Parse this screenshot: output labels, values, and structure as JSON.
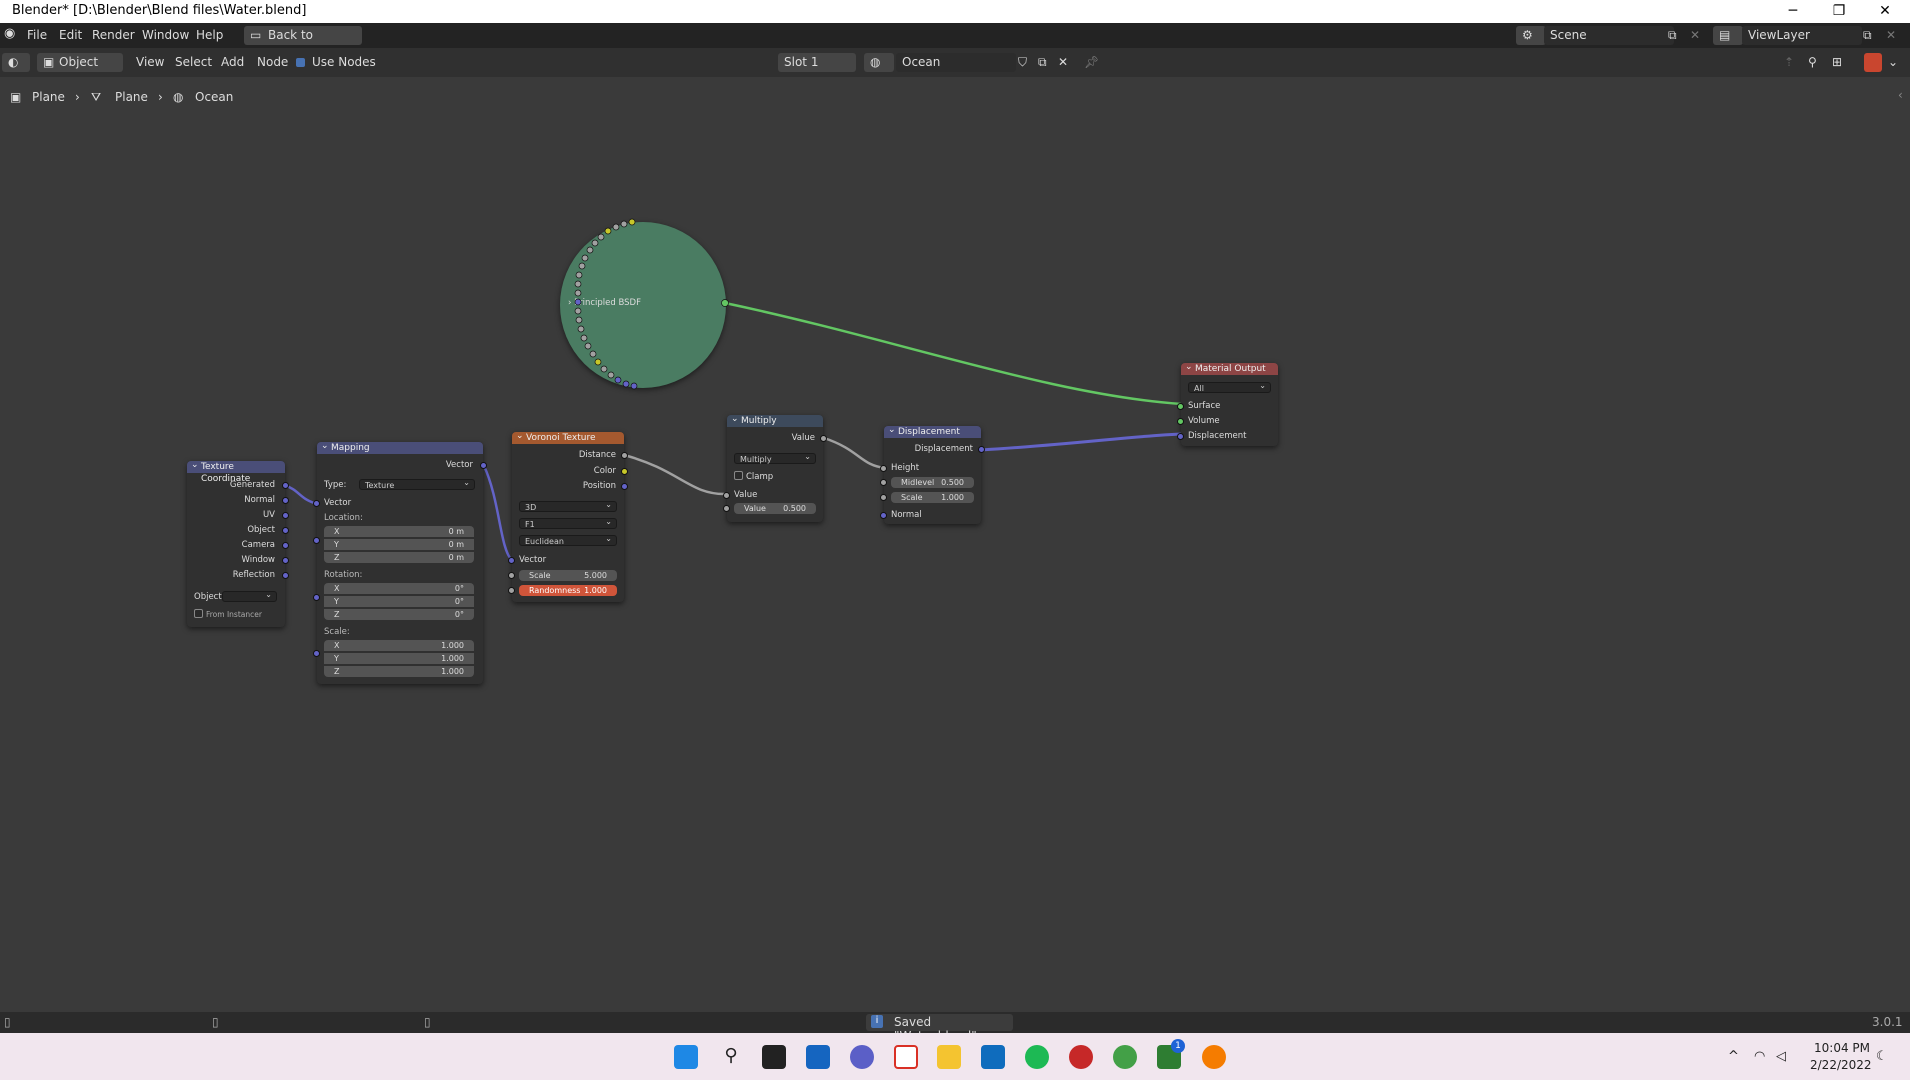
{
  "window": {
    "title": "Blender* [D:\\Blender\\Blend files\\Water.blend]"
  },
  "menu": {
    "file": "File",
    "edit": "Edit",
    "render": "Render",
    "window": "Window",
    "help": "Help",
    "back": "Back to Previous",
    "scene": "Scene",
    "viewlayer": "ViewLayer"
  },
  "header": {
    "mode": "Object",
    "view": "View",
    "select": "Select",
    "add": "Add",
    "node": "Node",
    "use_nodes": "Use Nodes",
    "slot": "Slot 1",
    "material": "Ocean"
  },
  "breadcrumb": {
    "object": "Plane",
    "mesh": "Plane",
    "material": "Ocean"
  },
  "nodes": {
    "principled": {
      "label": "Principled BSDF"
    },
    "texcoord": {
      "title": "Texture Coordinate",
      "outputs": [
        "Generated",
        "Normal",
        "UV",
        "Object",
        "Camera",
        "Window",
        "Reflection"
      ],
      "object_label": "Object:",
      "from_instancer": "From Instancer"
    },
    "mapping": {
      "title": "Mapping",
      "vector_out": "Vector",
      "type_label": "Type:",
      "type_value": "Texture",
      "vector_in": "Vector",
      "location": "Location:",
      "rotation": "Rotation:",
      "scale": "Scale:",
      "loc": [
        [
          "X",
          "0 m"
        ],
        [
          "Y",
          "0 m"
        ],
        [
          "Z",
          "0 m"
        ]
      ],
      "rot": [
        [
          "X",
          "0°"
        ],
        [
          "Y",
          "0°"
        ],
        [
          "Z",
          "0°"
        ]
      ],
      "scl": [
        [
          "X",
          "1.000"
        ],
        [
          "Y",
          "1.000"
        ],
        [
          "Z",
          "1.000"
        ]
      ]
    },
    "voronoi": {
      "title": "Voronoi Texture",
      "distance": "Distance",
      "color": "Color",
      "position": "Position",
      "dim": "3D",
      "feature": "F1",
      "metric": "Euclidean",
      "vector": "Vector",
      "scale_label": "Scale",
      "scale_value": "5.000",
      "rand_label": "Randomness",
      "rand_value": "1.000"
    },
    "multiply": {
      "title": "Multiply",
      "value_out": "Value",
      "op": "Multiply",
      "clamp": "Clamp",
      "value_in": "Value",
      "value_label": "Value",
      "value_value": "0.500"
    },
    "displacement": {
      "title": "Displacement",
      "disp_out": "Displacement",
      "height": "Height",
      "midlevel_label": "Midlevel",
      "midlevel_value": "0.500",
      "scale_label": "Scale",
      "scale_value": "1.000",
      "normal": "Normal"
    },
    "output": {
      "title": "Material Output",
      "target": "All",
      "surface": "Surface",
      "volume": "Volume",
      "displacement": "Displacement"
    }
  },
  "status": {
    "message": "Saved \"Water.blend\"",
    "version": "3.0.1"
  },
  "taskbar": {
    "time": "10:04 PM",
    "date": "2/22/2022",
    "badge": "1"
  },
  "colors": {
    "shader": "#63c763",
    "vector": "#6363c7",
    "float": "#a1a1a1",
    "color": "#c7c729",
    "input_head": "#7b3d3d",
    "tex_head": "#a4592f",
    "vec_head": "#4a4e78",
    "conv_head": "#3d4a5c",
    "out_head": "#8d4545",
    "bsdf": "#4a7c62"
  }
}
